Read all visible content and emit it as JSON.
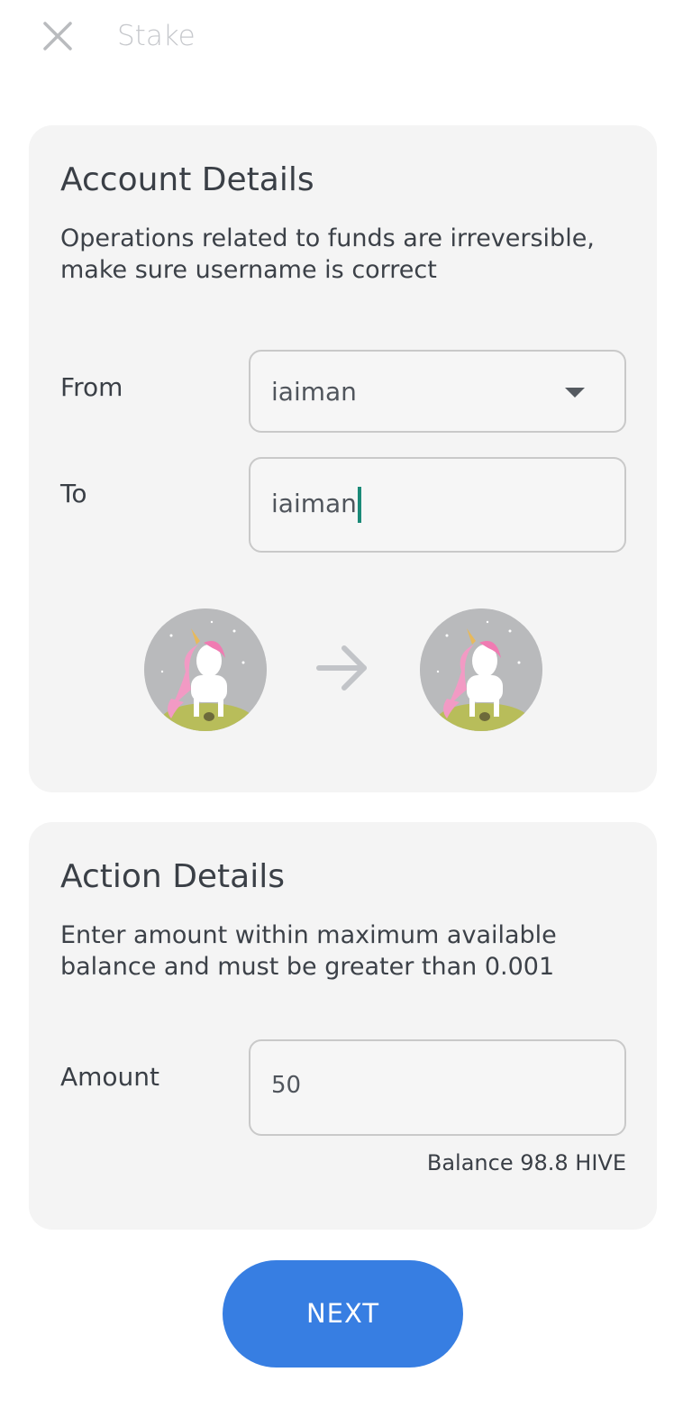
{
  "header": {
    "title": "Stake",
    "close_icon": "close-icon"
  },
  "account": {
    "title": "Account Details",
    "description": "Operations related to funds are irreversible, make sure username is correct",
    "from_label": "From",
    "from_value": "iaiman",
    "to_label": "To",
    "to_value": "iaiman"
  },
  "action": {
    "title": "Action Details",
    "description": "Enter amount within maximum available balance  and must be greater than 0.001",
    "amount_label": "Amount",
    "amount_value": "50",
    "balance_text": "Balance 98.8 HIVE"
  },
  "footer": {
    "next_label": "NEXT"
  },
  "colors": {
    "primary": "#377ee2",
    "card": "#f4f4f4",
    "cursor": "#1b8a78"
  }
}
